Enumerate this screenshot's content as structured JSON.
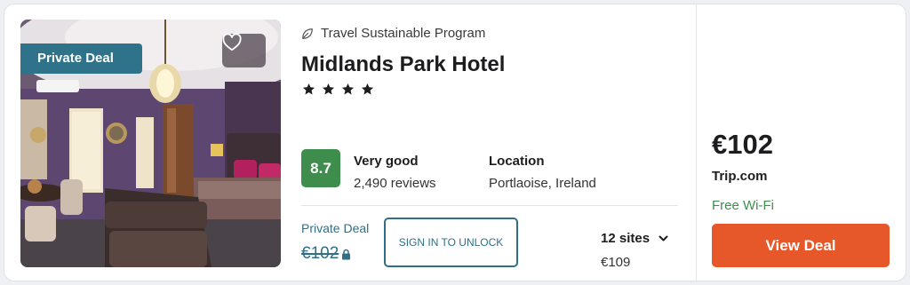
{
  "photo": {
    "badge": "Private Deal"
  },
  "hotel": {
    "program": "Travel Sustainable Program",
    "name": "Midlands Park Hotel",
    "stars": 4
  },
  "rating": {
    "score": "8.7",
    "label": "Very good",
    "reviews": "2,490 reviews"
  },
  "location": {
    "label": "Location",
    "value": "Portlaoise, Ireland"
  },
  "private_deal": {
    "label": "Private Deal",
    "price": "€102",
    "unlock_label": "SIGN IN TO UNLOCK"
  },
  "sites": {
    "label": "12 sites",
    "lowest": "€109"
  },
  "offer": {
    "price": "€102",
    "provider": "Trip.com",
    "amenity": "Free Wi-Fi",
    "button": "View Deal"
  },
  "colors": {
    "badge": "#2e7389",
    "score": "#3f8d4d",
    "button": "#e6582a",
    "private_text": "#2f6f88",
    "amenity": "#3f8d4d"
  },
  "icons": {
    "favorite": "heart-icon",
    "program": "leaf-icon",
    "lock": "lock-icon",
    "expand": "chevron-down-icon",
    "rating": "star-icon"
  }
}
